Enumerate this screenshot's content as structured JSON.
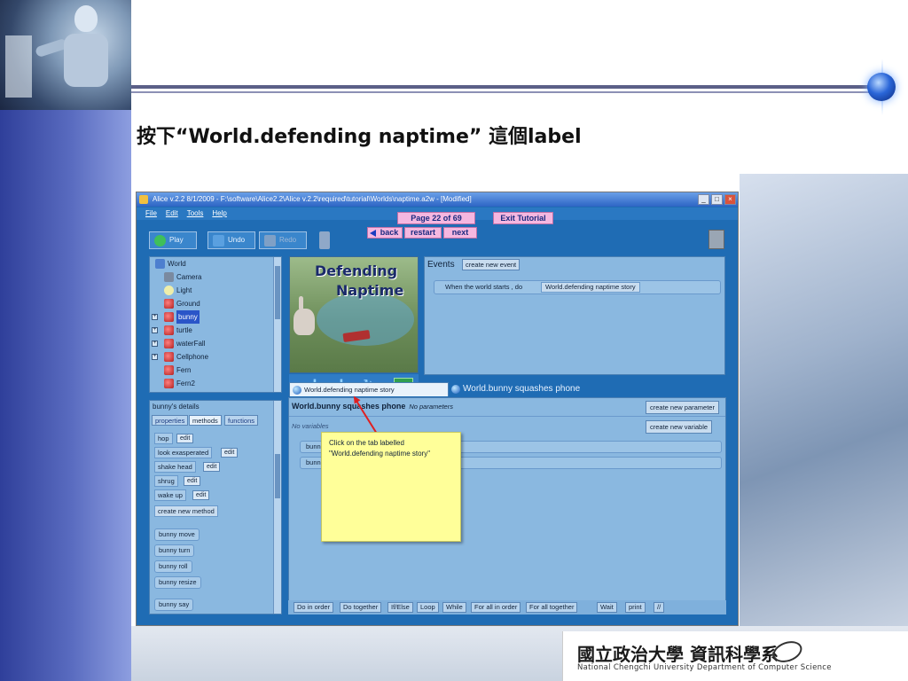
{
  "slide": {
    "title": "按下“World.defending naptime” 這個label",
    "logo_cn": "國立政治大學 資訊科學系",
    "logo_en": "National Chengchi University Department of Computer Science"
  },
  "alice": {
    "window_title": "Alice v.2.2 8/1/2009 - F:\\software\\Alice2.2\\Alice v.2.2\\required\\tutorial\\Worlds\\naptime.a2w - [Modified]",
    "menu": [
      "File",
      "Edit",
      "Tools",
      "Help"
    ],
    "tutorial": {
      "page": "Page 22 of 69",
      "exit": "Exit Tutorial",
      "back": "back",
      "restart": "restart",
      "next": "next"
    },
    "toolbar": {
      "play": "Play",
      "undo": "Undo",
      "redo": "Redo"
    },
    "object_tree": [
      "World",
      "Camera",
      "Light",
      "Ground",
      "bunny",
      "turtle",
      "waterFall",
      "Cellphone",
      "Fern",
      "Fern2"
    ],
    "selected_object": "bunny",
    "scene_title": [
      "Defending",
      "Naptime"
    ],
    "events": {
      "label": "Events",
      "create_button": "create new event",
      "trigger": "When the world starts , do",
      "method": "World.defending naptime story"
    },
    "tabs": {
      "active": "World.defending naptime story",
      "inactive": "World.bunny squashes phone"
    },
    "details": {
      "title": "bunny's details",
      "tabs": [
        "properties",
        "methods",
        "functions"
      ],
      "methods": [
        "hop",
        "look exasperated",
        "shake head",
        "shrug",
        "wake up"
      ],
      "edit": "edit",
      "create_method": "create new method",
      "builtins": [
        "bunny  move",
        "bunny  turn",
        "bunny  roll",
        "bunny  resize",
        "bunny  say"
      ]
    },
    "editor": {
      "header": "World.bunny squashes phone",
      "note": "No parameters",
      "no_variables": "No variables",
      "create_parameter": "create new parameter",
      "create_variable": "create new variable",
      "lines": [
        "bunn",
        "bunn"
      ]
    },
    "tooltip": "Click on the tab labelled \"World.defending naptime story\"",
    "controls": [
      "Do in order",
      "Do together",
      "If/Else",
      "Loop",
      "While",
      "For all in order",
      "For all together",
      "Wait",
      "print",
      "//"
    ]
  },
  "colors": {
    "alice_blue": "#1f6cb4",
    "tutorial_pink": "#f5b7e0",
    "tooltip_yellow": "#ffff99",
    "arrow_red": "#e02020"
  }
}
